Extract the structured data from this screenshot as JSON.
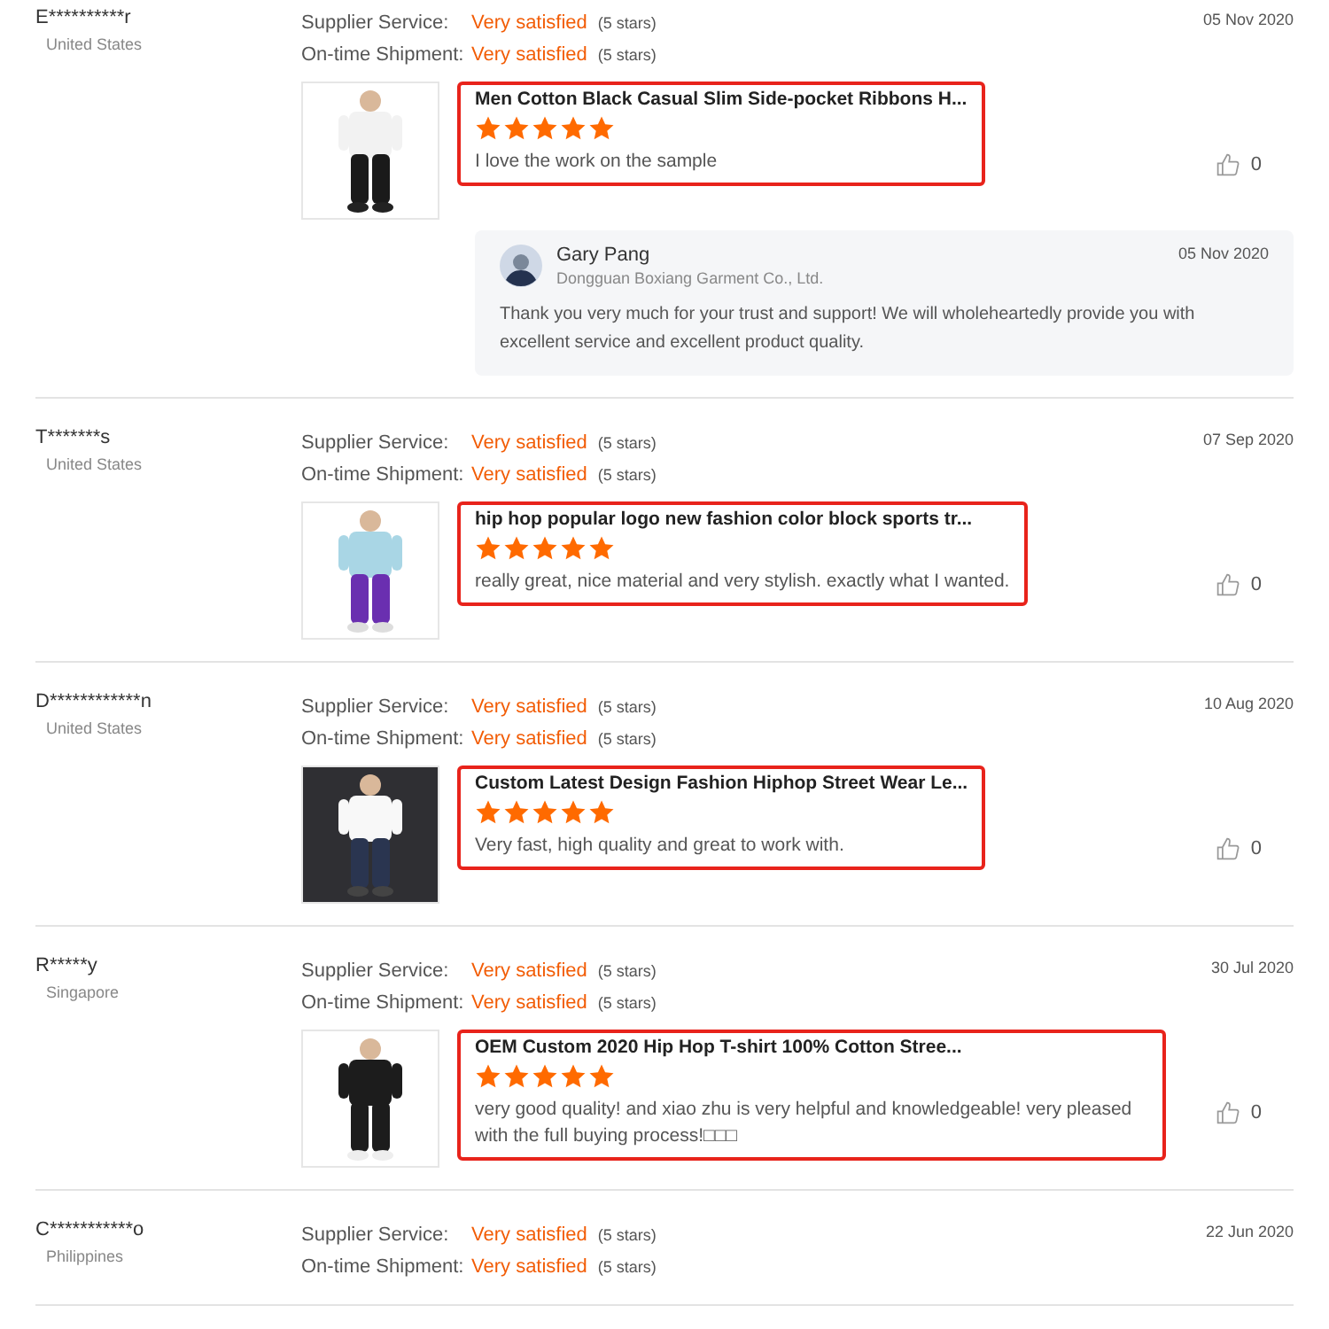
{
  "reviews": [
    {
      "name": "E**********r",
      "country": "United States",
      "date": "05 Nov 2020",
      "ratings": [
        {
          "label": "Supplier Service:",
          "value": "Very satisfied",
          "stars_text": "(5 stars)"
        },
        {
          "label": "On-time Shipment:",
          "value": "Very satisfied",
          "stars_text": "(5 stars)"
        }
      ],
      "product": {
        "title": "Men Cotton Black Casual Slim Side-pocket Ribbons H...",
        "stars": 5,
        "comment": "I love the work on the sample",
        "highlighted": true
      },
      "likes": "0",
      "reply": {
        "name": "Gary Pang",
        "company": "Dongguan Boxiang Garment Co., Ltd.",
        "date": "05 Nov 2020",
        "text": "Thank you very much for your trust and support! We will wholeheartedly provide you with excellent service and excellent product quality."
      }
    },
    {
      "name": "T*******s",
      "country": "United States",
      "date": "07 Sep 2020",
      "ratings": [
        {
          "label": "Supplier Service:",
          "value": "Very satisfied",
          "stars_text": "(5 stars)"
        },
        {
          "label": "On-time Shipment:",
          "value": "Very satisfied",
          "stars_text": "(5 stars)"
        }
      ],
      "product": {
        "title": "hip hop popular logo new fashion color block sports tr...",
        "stars": 5,
        "comment": "really great, nice material and very stylish. exactly what I wanted.",
        "highlighted": true
      },
      "likes": "0"
    },
    {
      "name": "D************n",
      "country": "United States",
      "date": "10 Aug 2020",
      "ratings": [
        {
          "label": "Supplier Service:",
          "value": "Very satisfied",
          "stars_text": "(5 stars)"
        },
        {
          "label": "On-time Shipment:",
          "value": "Very satisfied",
          "stars_text": "(5 stars)"
        }
      ],
      "product": {
        "title": "Custom Latest Design Fashion Hiphop Street Wear Le...",
        "stars": 5,
        "comment": "Very fast, high quality and great to work with.",
        "highlighted": true
      },
      "likes": "0"
    },
    {
      "name": "R*****y",
      "country": "Singapore",
      "date": "30 Jul 2020",
      "ratings": [
        {
          "label": "Supplier Service:",
          "value": "Very satisfied",
          "stars_text": "(5 stars)"
        },
        {
          "label": "On-time Shipment:",
          "value": "Very satisfied",
          "stars_text": "(5 stars)"
        }
      ],
      "product": {
        "title": "OEM Custom 2020 Hip Hop T-shirt 100% Cotton Stree...",
        "stars": 5,
        "comment": "very good quality! and xiao zhu is very helpful and knowledgeable! very pleased with the full buying process!□□□",
        "highlighted": true
      },
      "likes": "0"
    },
    {
      "name": "C***********o",
      "country": "Philippines",
      "date": "22 Jun 2020",
      "ratings": [
        {
          "label": "Supplier Service:",
          "value": "Very satisfied",
          "stars_text": "(5 stars)"
        },
        {
          "label": "On-time Shipment:",
          "value": "Very satisfied",
          "stars_text": "(5 stars)"
        }
      ]
    }
  ]
}
